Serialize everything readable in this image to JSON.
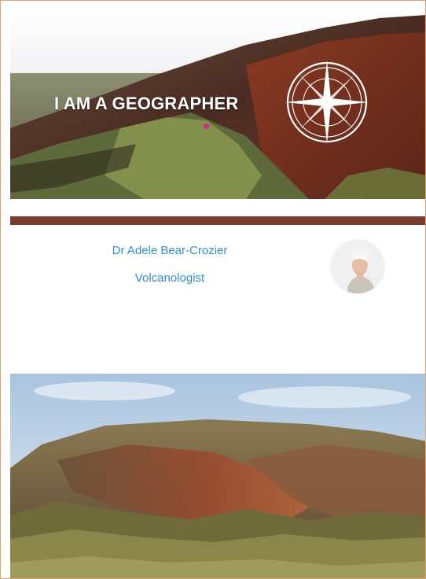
{
  "banner": {
    "title": "I AM A GEOGRAPHER"
  },
  "profile": {
    "name": "Dr Adele Bear-Crozier",
    "role": "Volcanologist"
  },
  "colors": {
    "divider": "#7a3a2c",
    "profile_text": "#2f8fe0",
    "page_border": "#e0a070"
  }
}
